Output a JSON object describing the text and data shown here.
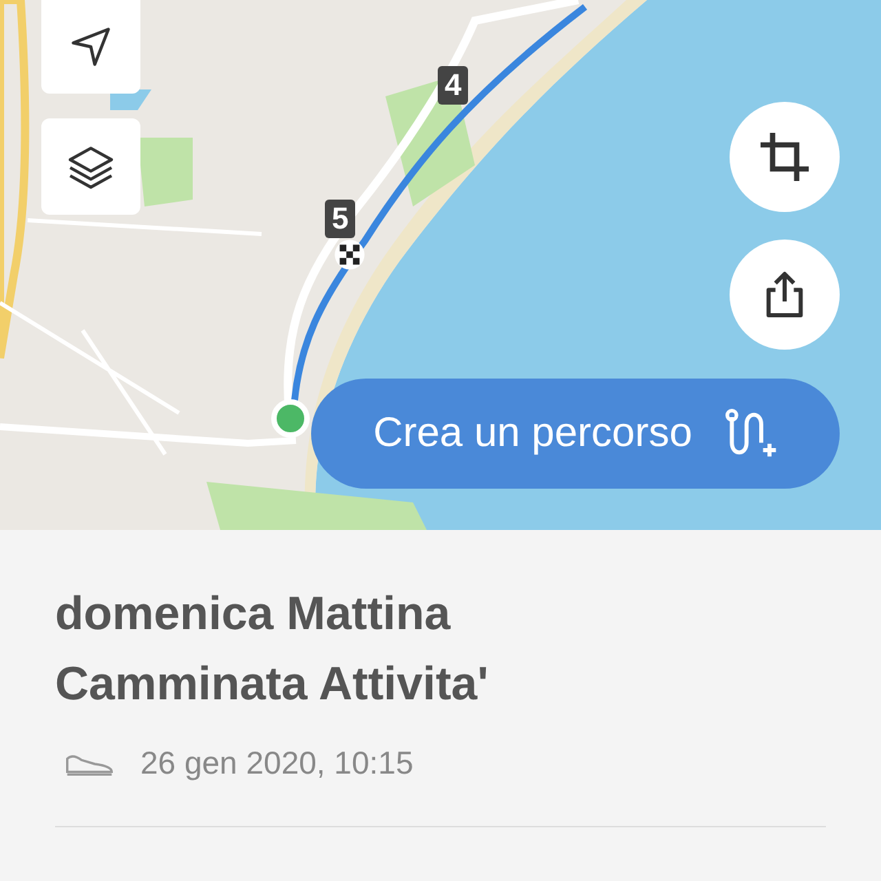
{
  "map": {
    "markers": [
      {
        "label": "4"
      },
      {
        "label": "5"
      }
    ],
    "create_route_button": {
      "label": "Crea un percorso"
    }
  },
  "activity": {
    "title": "domenica Mattina Camminata Attivita'",
    "date": "26 gen 2020, 10:15"
  }
}
